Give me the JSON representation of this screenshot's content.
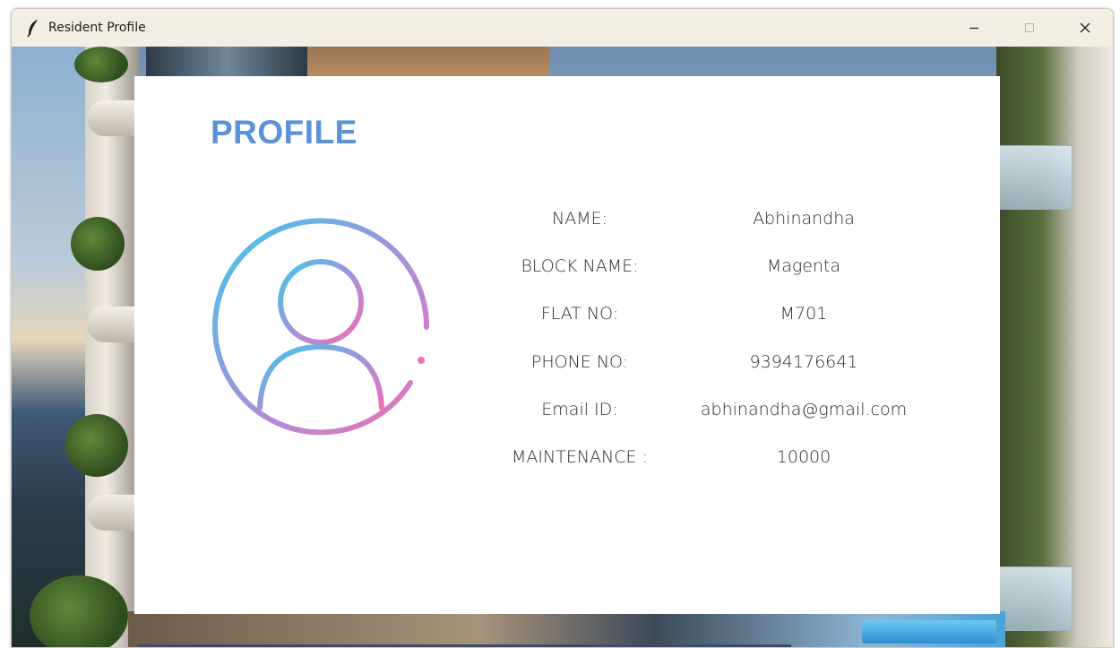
{
  "window": {
    "title": "Resident Profile",
    "controls": {
      "minimize_icon": "minimize-icon",
      "maximize_icon": "maximize-icon",
      "close_icon": "close-icon"
    }
  },
  "profile": {
    "heading": "PROFILE",
    "avatar_icon": "user-avatar-icon",
    "fields": [
      {
        "label": "NAME:",
        "value": "Abhinandha"
      },
      {
        "label": "BLOCK NAME:",
        "value": "Magenta"
      },
      {
        "label": "FLAT NO:",
        "value": "M701"
      },
      {
        "label": "PHONE NO:",
        "value": "9394176641"
      },
      {
        "label": "Email ID:",
        "value": "abhinandha@gmail.com"
      },
      {
        "label": "MAINTENANCE :",
        "value": "10000"
      }
    ]
  },
  "colors": {
    "heading": "#5b92d6",
    "avatar_gradient_start": "#3ec8ea",
    "avatar_gradient_mid": "#a98fd8",
    "avatar_gradient_end": "#f06fb6",
    "card_background": "#ffffff",
    "titlebar": "#f3eee4"
  }
}
